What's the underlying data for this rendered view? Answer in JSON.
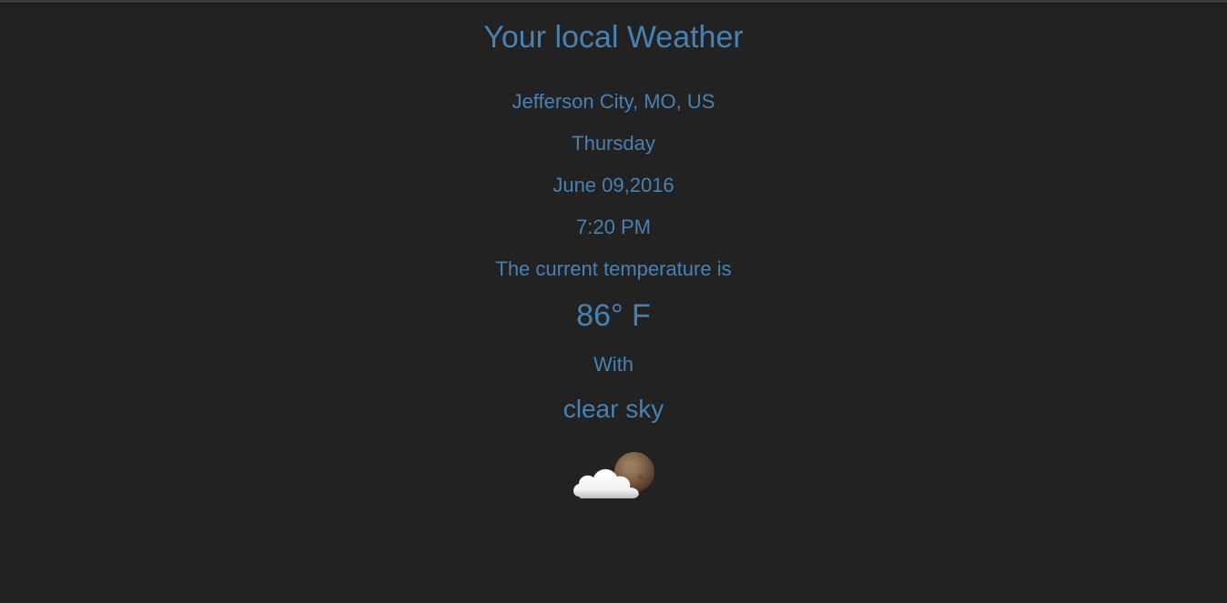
{
  "weather": {
    "title": "Your local Weather",
    "location": "Jefferson City, MO, US",
    "day": "Thursday",
    "date": "June 09,2016",
    "time": "7:20 PM",
    "temperature_label": "The current temperature is",
    "temperature": "86° F",
    "with_label": "With",
    "condition": "clear sky",
    "condition_icon": "night-partly-cloudy-icon"
  },
  "colors": {
    "background": "#222222",
    "text": "#4682b4"
  }
}
